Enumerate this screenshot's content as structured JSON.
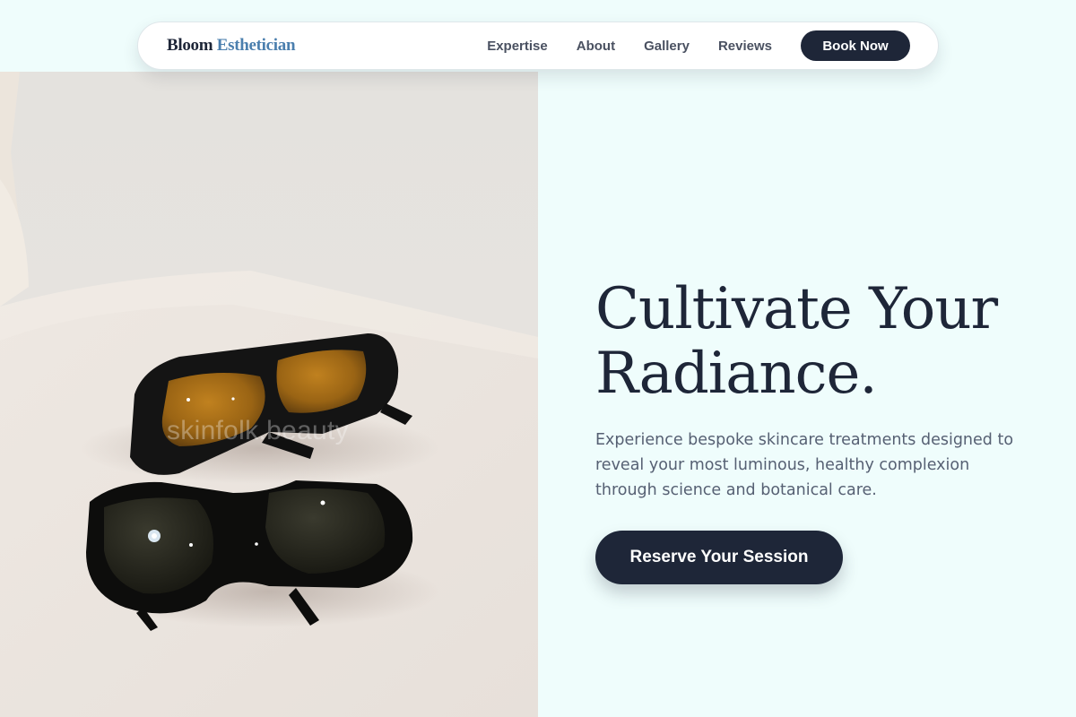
{
  "nav": {
    "brand_part1": "Bloom",
    "brand_part2": "Esthetician",
    "links": [
      "Expertise",
      "About",
      "Gallery",
      "Reviews"
    ],
    "book_label": "Book Now"
  },
  "hero": {
    "image_watermark": "skinfolk.beauty",
    "headline_line1": "Cultivate Your",
    "headline_line2": "Radiance.",
    "subtext": "Experience bespoke skincare treatments designed to reveal your most luminous, healthy complexion through science and botanical care.",
    "cta_label": "Reserve Your Session"
  },
  "colors": {
    "page_background": "#effdfc",
    "navy": "#1e2638",
    "brand_accent": "#4b7fae",
    "body_text": "#566073"
  }
}
